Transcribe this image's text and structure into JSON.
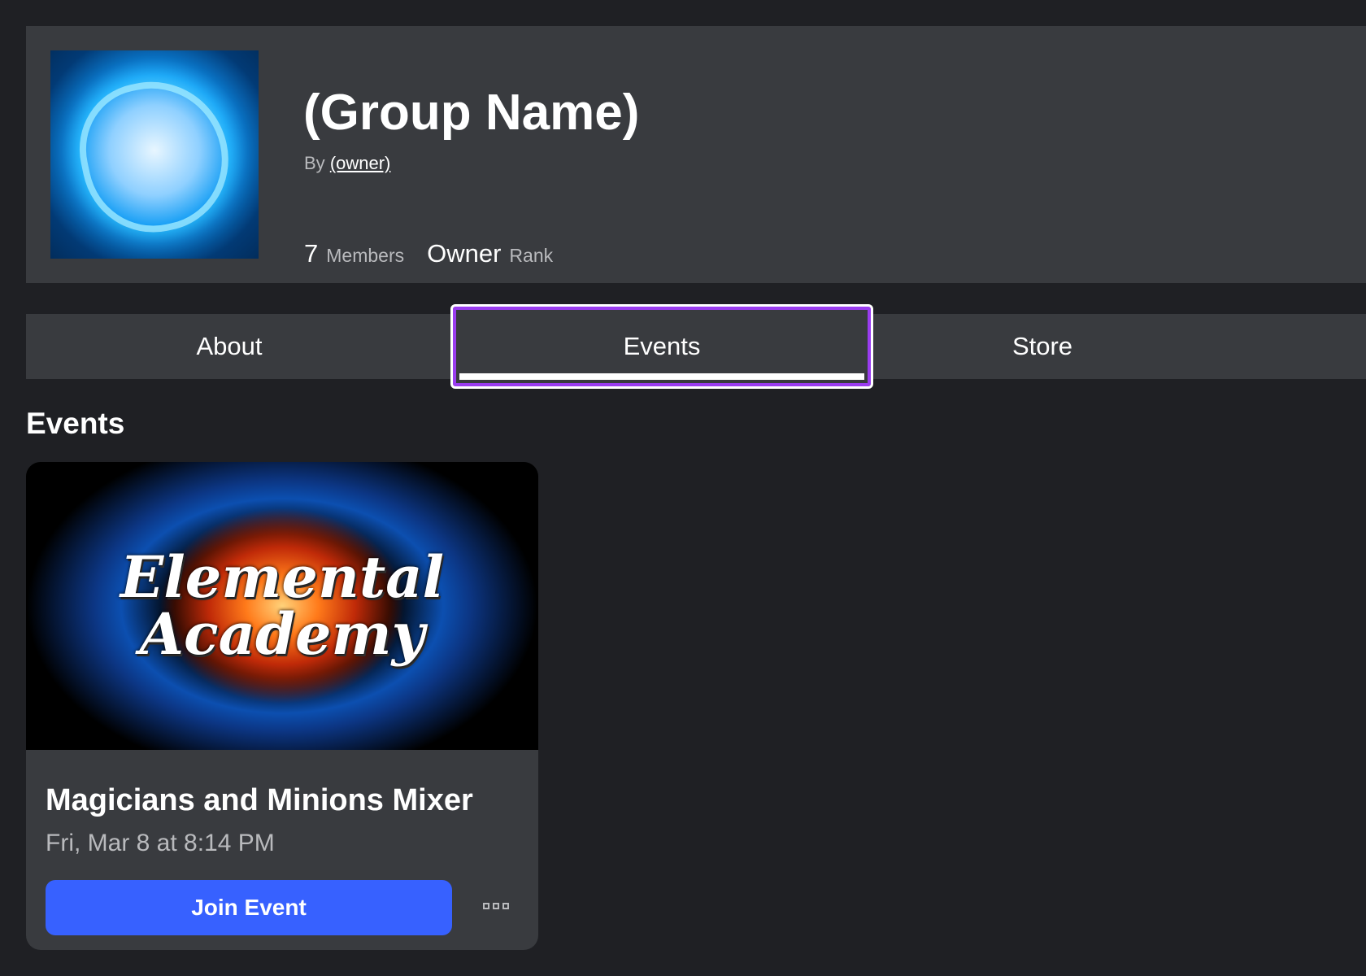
{
  "group": {
    "name": "(Group Name)",
    "by_label": "By",
    "owner": "(owner)",
    "members_count": "7",
    "members_label": "Members",
    "rank": "Owner",
    "rank_label": "Rank"
  },
  "tabs": [
    {
      "label": "About"
    },
    {
      "label": "Events"
    },
    {
      "label": "Store"
    }
  ],
  "events_section": {
    "title": "Events"
  },
  "event": {
    "banner_logo": "Elemental Academy",
    "title": "Magicians and Minions Mixer",
    "date": "Fri, Mar 8 at 8:14 PM",
    "join_label": "Join Event"
  },
  "colors": {
    "accent": "#3761ff",
    "focus": "#9a3cf0",
    "panel": "#393b3f",
    "background": "#1f2024"
  }
}
